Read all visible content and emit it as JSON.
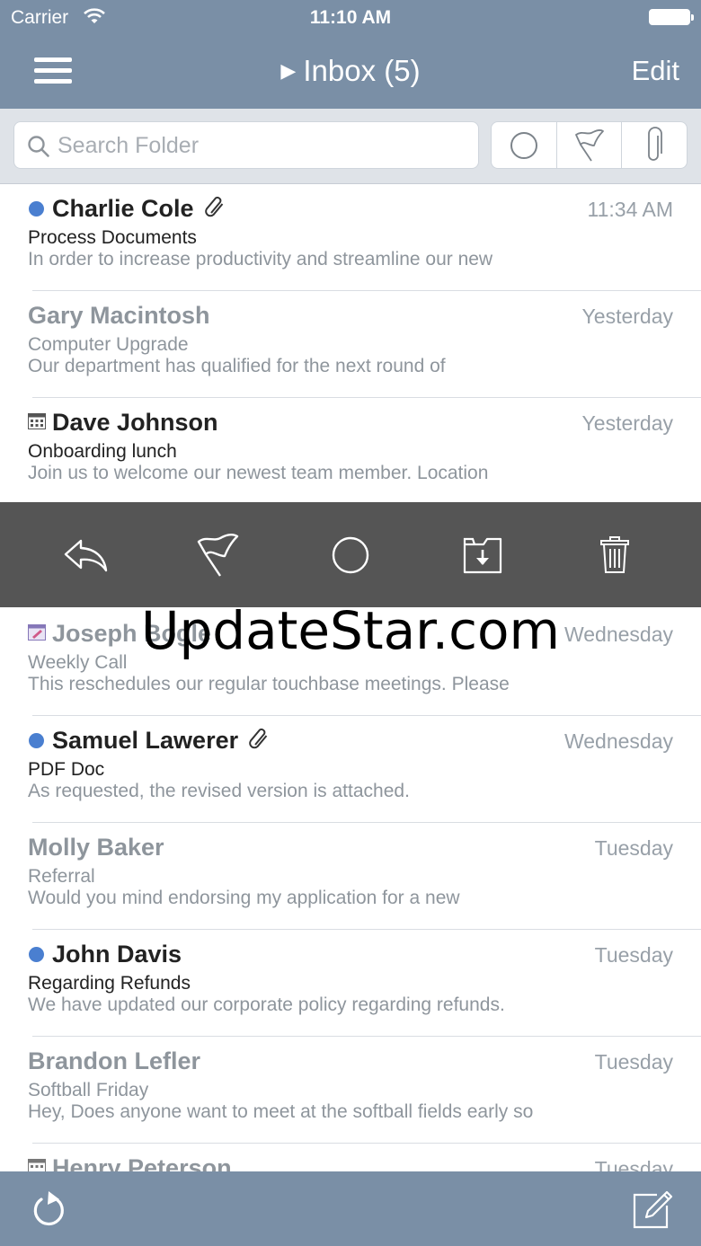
{
  "status": {
    "carrier": "Carrier",
    "time": "11:10 AM"
  },
  "nav": {
    "title": "Inbox (5)",
    "edit": "Edit"
  },
  "search": {
    "placeholder": "Search Folder"
  },
  "filters": [
    "unread-filter-icon",
    "flag-filter-icon",
    "attachment-filter-icon"
  ],
  "messages": [
    {
      "sender": "Charlie Cole",
      "time": "11:34 AM",
      "subject": "Process Documents",
      "preview": "In order to increase productivity and streamline our new"
    },
    {
      "sender": "Gary Macintosh",
      "time": "Yesterday",
      "subject": "Computer Upgrade",
      "preview": "Our department has qualified for the next round of"
    },
    {
      "sender": "Dave Johnson",
      "time": "Yesterday",
      "subject": "Onboarding lunch",
      "preview": "Join us to welcome our newest team member. Location"
    },
    {
      "sender": "Joseph Bogle",
      "time": "Wednesday",
      "subject": "Weekly Call",
      "preview": "This reschedules our regular touchbase meetings. Please"
    },
    {
      "sender": "Samuel Lawerer",
      "time": "Wednesday",
      "subject": "PDF Doc",
      "preview": "As requested, the revised version is attached."
    },
    {
      "sender": "Molly Baker",
      "time": "Tuesday",
      "subject": "Referral",
      "preview": "Would you mind endorsing my application for a new"
    },
    {
      "sender": "John Davis",
      "time": "Tuesday",
      "subject": "Regarding Refunds",
      "preview": "We have updated our corporate policy regarding refunds."
    },
    {
      "sender": "Brandon Lefler",
      "time": "Tuesday",
      "subject": "Softball Friday",
      "preview": "Hey, Does anyone want to meet at the softball fields early so"
    },
    {
      "sender": "Henry Peterson",
      "time": "Tuesday",
      "subject": "",
      "preview": ""
    }
  ],
  "actions": [
    "reply-icon",
    "flag-icon",
    "mark-unread-icon",
    "move-folder-icon",
    "trash-icon"
  ],
  "watermark": "UpdateStar.com",
  "colors": {
    "bar": "#7a8fa6",
    "unread_dot": "#4a7fd0",
    "action_bar": "#555555"
  }
}
